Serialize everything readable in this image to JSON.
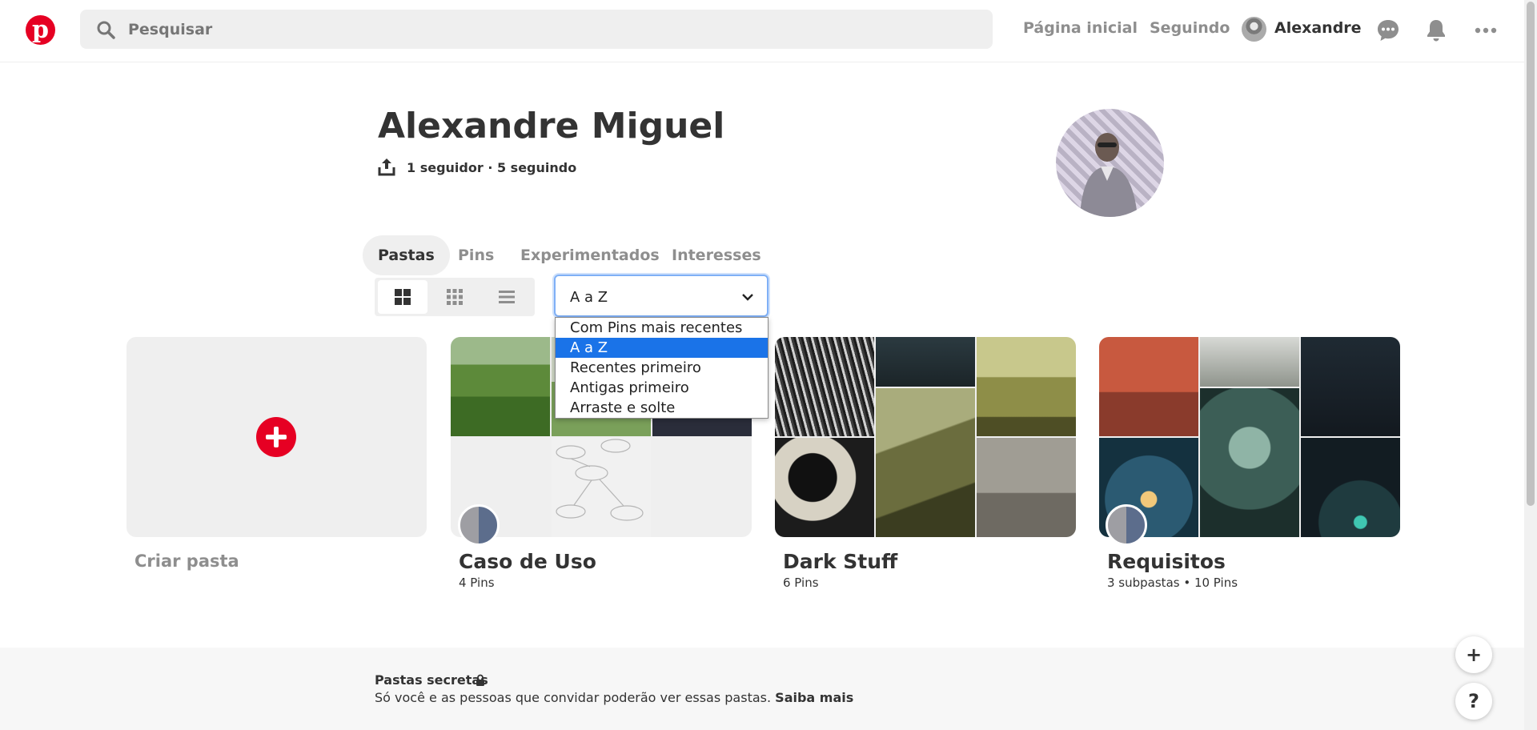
{
  "header": {
    "search_placeholder": "Pesquisar",
    "nav_home": "Página inicial",
    "nav_following": "Seguindo",
    "user_name": "Alexandre"
  },
  "profile": {
    "name": "Alexandre Miguel",
    "stats": "1 seguidor · 5 seguindo"
  },
  "tabs": [
    {
      "label": "Pastas",
      "active": true
    },
    {
      "label": "Pins",
      "active": false
    },
    {
      "label": "Experimentados",
      "active": false
    },
    {
      "label": "Interesses",
      "active": false
    }
  ],
  "sort": {
    "selected": "A a Z",
    "options": [
      "Com Pins mais recentes",
      "A a Z",
      "Recentes primeiro",
      "Antigas primeiro",
      "Arraste e solte"
    ]
  },
  "create_board_label": "Criar pasta",
  "boards": [
    {
      "title": "Caso de Uso",
      "meta": "4 Pins"
    },
    {
      "title": "Dark Stuff",
      "meta": "6 Pins"
    },
    {
      "title": "Requisitos",
      "meta": "3 subpastas • 10 Pins"
    }
  ],
  "secret": {
    "title": "Pastas secretas",
    "description": "Só você e as pessoas que convidar poderão ver essas pastas.",
    "link": "Saiba mais"
  },
  "fab": {
    "add": "+",
    "help": "?"
  },
  "colors": {
    "brand": "#e60023",
    "selected_option": "#1a73e8",
    "tile_bg": "#efefef"
  }
}
